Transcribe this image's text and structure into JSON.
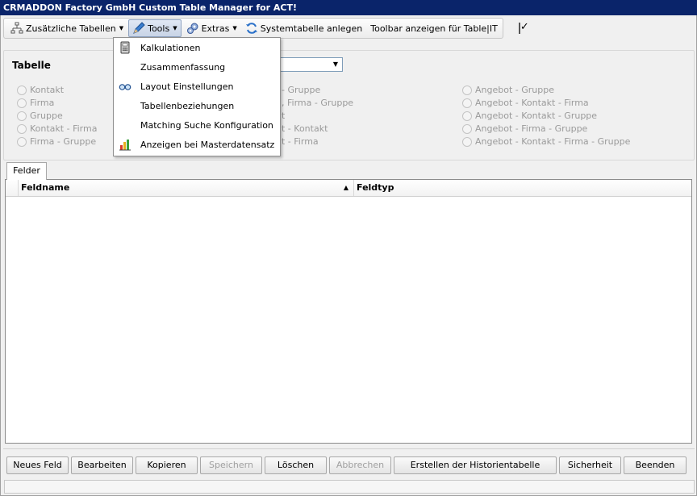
{
  "window": {
    "title": "CRMADDON Factory GmbH Custom Table Manager for ACT!"
  },
  "toolbar": {
    "zusaetzliche": "Zusätzliche Tabellen",
    "tools": "Tools",
    "extras": "Extras",
    "systemtabelle": "Systemtabelle anlegen",
    "toolbar_anzeigen": "Toolbar anzeigen für Table|IT",
    "toolbar_anzeigen_checked": true
  },
  "tools_menu": {
    "items": [
      {
        "label": "Kalkulationen",
        "icon": "calculator-icon"
      },
      {
        "label": "Zusammenfassung",
        "icon": ""
      },
      {
        "label": "Layout Einstellungen",
        "icon": "glasses-icon"
      },
      {
        "label": "Tabellenbeziehungen",
        "icon": ""
      },
      {
        "label": "Matching Suche Konfiguration",
        "icon": ""
      },
      {
        "label": "Anzeigen bei Masterdatensatz",
        "icon": "bar-chart-icon"
      }
    ]
  },
  "tabelle": {
    "label": "Tabelle",
    "col1": [
      "Kontakt",
      "Firma",
      "Gruppe",
      "Kontakt - Firma",
      "Firma - Gruppe"
    ],
    "col2": [
      "- Gruppe",
      ", Firma - Gruppe",
      "t",
      "t - Kontakt",
      "t - Firma"
    ],
    "col3": [
      "Angebot - Gruppe",
      "Angebot - Kontakt - Firma",
      "Angebot - Kontakt - Gruppe",
      "Angebot - Firma - Gruppe",
      "Angebot - Kontakt - Firma - Gruppe"
    ]
  },
  "tabs": {
    "felder": "Felder"
  },
  "grid": {
    "col_feldname": "Feldname",
    "col_feldtyp": "Feldtyp",
    "sort": "ascending"
  },
  "buttons": {
    "neues_feld": "Neues Feld",
    "bearbeiten": "Bearbeiten",
    "kopieren": "Kopieren",
    "speichern": "Speichern",
    "loeschen": "Löschen",
    "abbrechen": "Abbrechen",
    "historie": "Erstellen der Historientabelle",
    "sicherheit": "Sicherheit",
    "beenden": "Beenden"
  }
}
